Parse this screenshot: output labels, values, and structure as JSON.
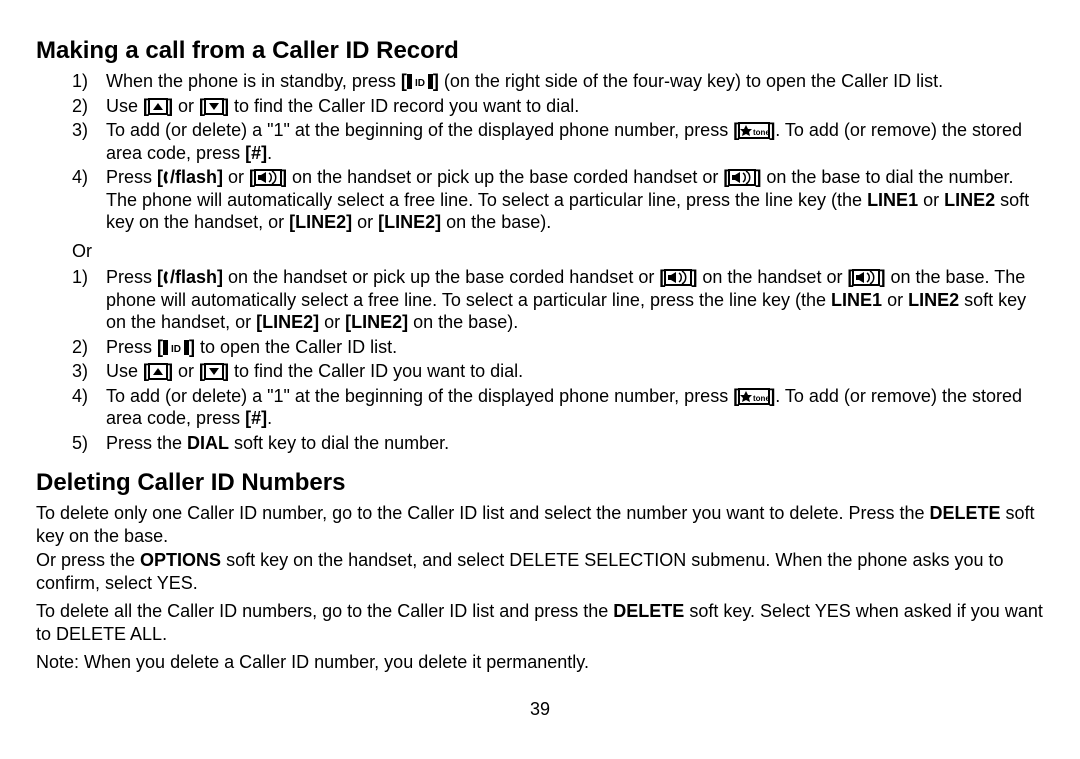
{
  "section1": {
    "heading": "Making a call from a Caller ID Record",
    "listA": {
      "i1a": "When the phone is in standby, press ",
      "i1b": " (on the right side of the four-way key) to open the Caller ID list.",
      "i2a": "Use ",
      "i2b": " or ",
      "i2c": " to find the Caller ID record you want to dial.",
      "i3a": "To add (or delete) a \"1\" at the beginning of the displayed phone number, press ",
      "i3b": ". To add (or remove) the stored area code, press ",
      "i3c": "[#]",
      "i3d": ".",
      "i4a": "Press ",
      "i4b": "[",
      "i4b2": "/flash]",
      "i4c": " or ",
      "i4d": " on the handset or pick up the base corded handset or ",
      "i4e": " on the base to dial the number.",
      "i4f": "The phone will automatically select a free line. To select a particular line, press the line key (the ",
      "i4g": "LINE1",
      "i4h": " or ",
      "i4i": "LINE2",
      "i4j": " soft key on the handset, or ",
      "i4k": "[LINE2]",
      "i4l": " or ",
      "i4m": "[LINE2]",
      "i4n": " on the base)."
    },
    "or": "Or",
    "listB": {
      "i1a": "Press ",
      "i1b": "[",
      "i1b2": "/flash]",
      "i1c": " on the handset or pick up the base corded handset or ",
      "i1d": " on the handset or ",
      "i1e": " on the base. The phone will automatically select a free line. To select a particular line, press the line key (the ",
      "i1f": "LINE1",
      "i1g": " or ",
      "i1h": "LINE2",
      "i1i": " soft key on the handset, or ",
      "i1j": "[LINE2]",
      "i1k": " or ",
      "i1l": "[LINE2]",
      "i1m": " on the base).",
      "i2a": "Press ",
      "i2b": " to open the Caller ID list.",
      "i3a": "Use ",
      "i3b": " or ",
      "i3c": " to find the Caller ID you want to dial.",
      "i4a": "To add (or delete) a \"1\" at the beginning of the displayed phone number, press ",
      "i4b": ". To add (or remove) the stored area code, press ",
      "i4c": "[#]",
      "i4d": ".",
      "i5a": "Press the ",
      "i5b": "DIAL",
      "i5c": " soft key to dial the number."
    }
  },
  "section2": {
    "heading": "Deleting Caller ID Numbers",
    "p1a": "To delete only one Caller ID number, go to the Caller ID list and select the number you want to delete. Press the ",
    "p1b": "DELETE",
    "p1c": " soft key on the base.",
    "p2a": "Or press the ",
    "p2b": "OPTIONS",
    "p2c": " soft key on the handset, and select DELETE SELECTION submenu. When the phone asks you to confirm, select YES.",
    "p3a": "To delete all the Caller ID numbers, go to the Caller ID list and press the ",
    "p3b": "DELETE",
    "p3c": " soft key. Select YES when asked if you want to DELETE ALL.",
    "p4": "Note: When you delete a Caller ID number, you delete it permanently."
  },
  "page": "39"
}
